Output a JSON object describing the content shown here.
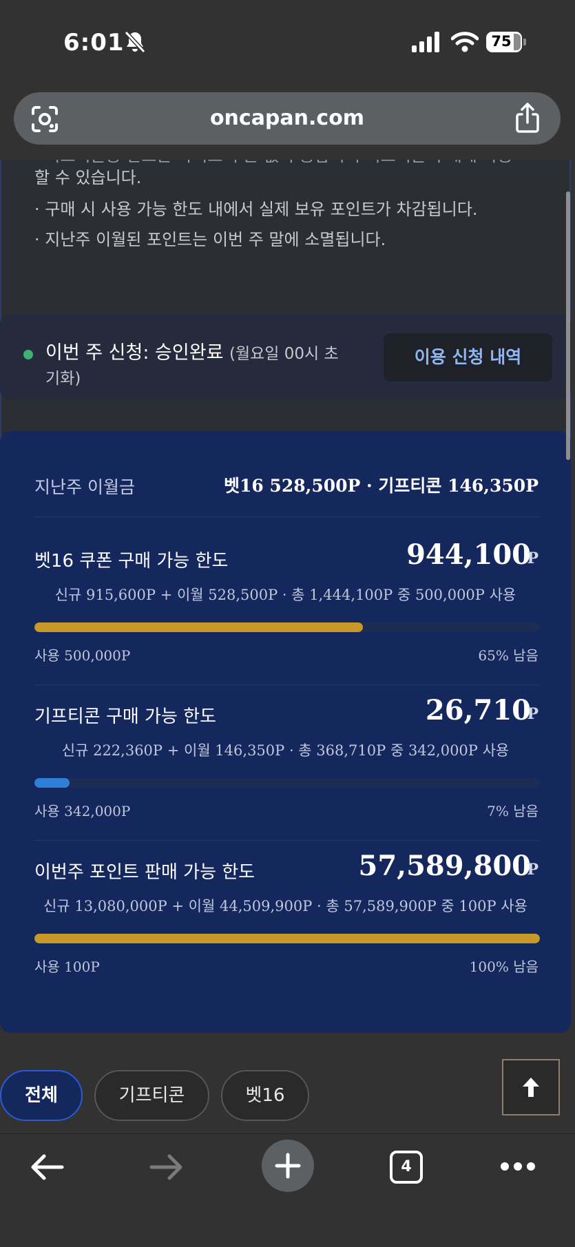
{
  "status_bar": {
    "time": "6:01",
    "battery": "75"
  },
  "browser": {
    "url": "oncapan.com",
    "open_tabs": "4"
  },
  "notice": {
    "partial_line": "· 기프티콘용 한도는 사이트 구분 없이 통합되어 기프티콘 구매에 사용",
    "lines": [
      "할 수 있습니다.",
      "· 구매 시 사용 가능 한도 내에서 실제 보유 포인트가 차감됩니다.",
      "· 지난주 이월된 포인트는 이번 주 말에 소멸됩니다."
    ]
  },
  "weekly_status": {
    "label": "이번 주 신청: 승인완료",
    "note_line1": "(월요일 00시 초",
    "note_line2": "기화)",
    "history_button": "이용 신청 내역"
  },
  "carryover": {
    "label": "지난주 이월금",
    "values": "벳16 528,500P · 기프티콘 146,350P"
  },
  "limits": [
    {
      "title": "벳16 쿠폰 구매 가능 한도",
      "amount": "944,100",
      "unit": "P",
      "detail": "신규 915,600P + 이월 528,500P · 총 1,444,100P 중 500,000P 사용",
      "used": "사용 500,000P",
      "remaining": "65% 남음",
      "remaining_fraction": 0.65,
      "bar_color": "#c79a28"
    },
    {
      "title": "기프티콘 구매 가능 한도",
      "amount": "26,710",
      "unit": "P",
      "detail": "신규 222,360P + 이월 146,350P · 총 368,710P 중 342,000P 사용",
      "used": "사용 342,000P",
      "remaining": "7% 남음",
      "remaining_fraction": 0.07,
      "bar_color": "#2f7fd6"
    },
    {
      "title": "이번주 포인트 판매 가능 한도",
      "amount": "57,589,800",
      "unit": "P",
      "detail": "신규 13,080,000P + 이월 44,509,900P · 총 57,589,900P 중 100P 사용",
      "used": "사용 100P",
      "remaining": "100% 남음",
      "remaining_fraction": 1.0,
      "bar_color": "#c79a28"
    }
  ],
  "filters": {
    "items": [
      "전체",
      "기프티콘",
      "벳16"
    ],
    "active": "전체"
  }
}
